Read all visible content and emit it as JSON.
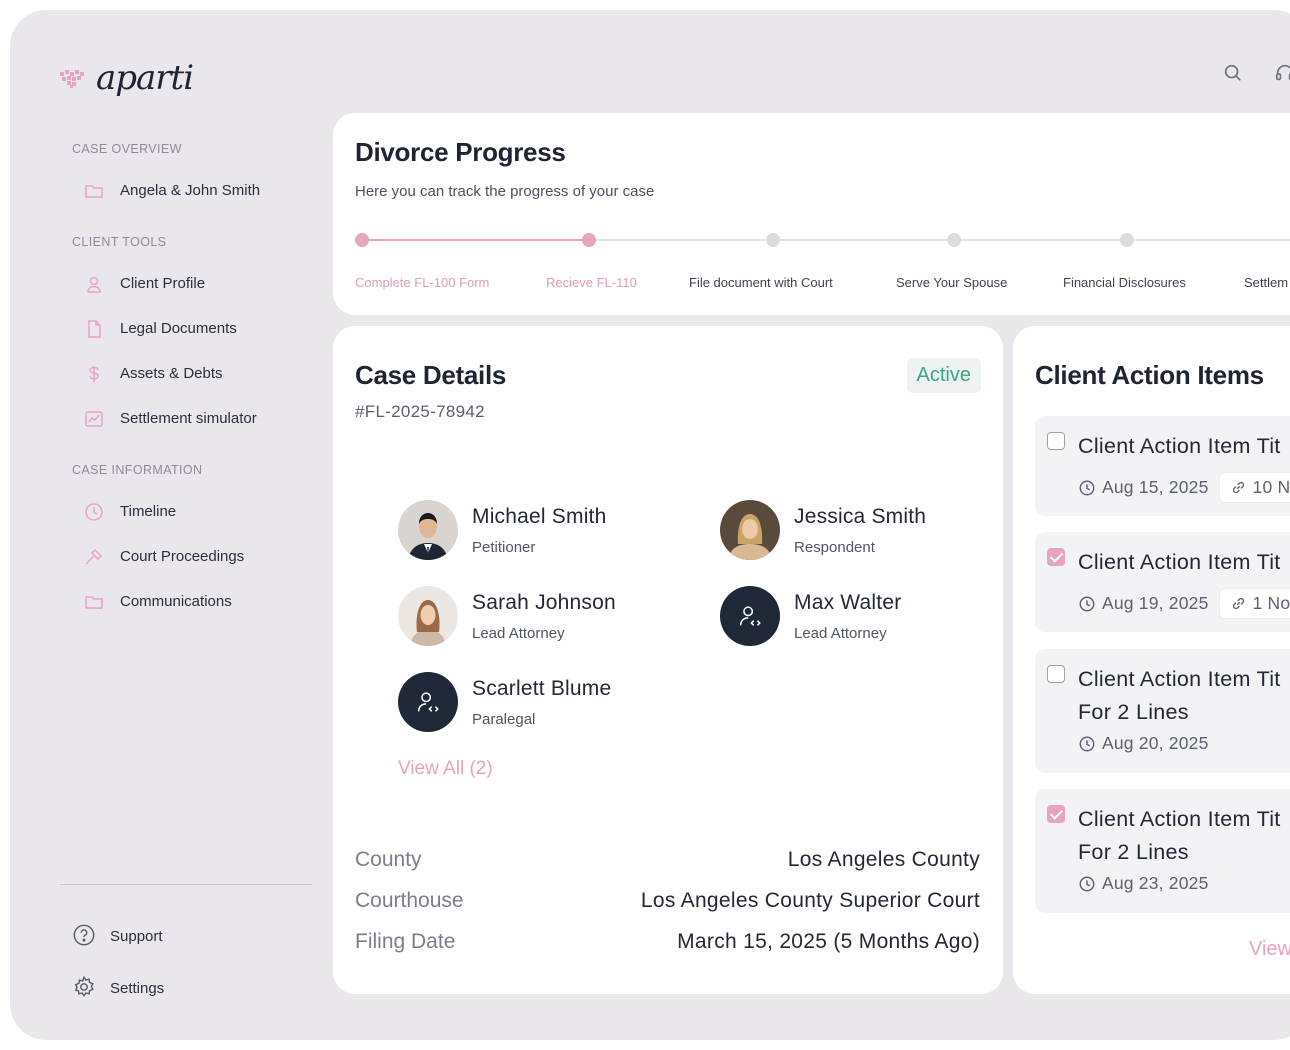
{
  "brand": {
    "name": "aparti",
    "accent": "#e7a3c0"
  },
  "top_icons": [
    "search-icon",
    "headset-icon"
  ],
  "sidebar": {
    "sections": [
      {
        "heading": "CASE OVERVIEW",
        "items": [
          {
            "label": "Angela & John Smith",
            "icon": "folder-icon"
          }
        ]
      },
      {
        "heading": "CLIENT TOOLS",
        "items": [
          {
            "label": "Client Profile",
            "icon": "user-icon"
          },
          {
            "label": "Legal Documents",
            "icon": "document-icon"
          },
          {
            "label": "Assets & Debts",
            "icon": "dollar-icon"
          },
          {
            "label": "Settlement simulator",
            "icon": "chart-icon"
          }
        ]
      },
      {
        "heading": "CASE INFORMATION",
        "items": [
          {
            "label": "Timeline",
            "icon": "clock-icon"
          },
          {
            "label": "Court Proceedings",
            "icon": "gavel-icon"
          },
          {
            "label": "Communications",
            "icon": "folder-icon"
          }
        ]
      }
    ],
    "bottom": [
      {
        "label": "Support",
        "icon": "help-icon"
      },
      {
        "label": "Settings",
        "icon": "gear-icon"
      }
    ]
  },
  "progress": {
    "title": "Divorce Progress",
    "subtitle": "Here you can track the progress of your case",
    "completed_steps": 2,
    "steps": [
      "Complete FL-100 Form",
      "Recieve FL-110",
      "File document with Court",
      "Serve Your Spouse",
      "Financial Disclosures",
      "Settlem"
    ]
  },
  "case_details": {
    "title": "Case Details",
    "case_number": "#FL-2025-78942",
    "status": "Active",
    "status_color": "#3aa58a",
    "people": [
      {
        "name": "Michael Smith",
        "role": "Petitioner",
        "avatar": "photo"
      },
      {
        "name": "Jessica Smith",
        "role": "Respondent",
        "avatar": "photo"
      },
      {
        "name": "Sarah Johnson",
        "role": "Lead Attorney",
        "avatar": "photo"
      },
      {
        "name": "Max Walter",
        "role": "Lead Attorney",
        "avatar": "placeholder"
      },
      {
        "name": "Scarlett Blume",
        "role": "Paralegal",
        "avatar": "placeholder"
      }
    ],
    "view_all": "View All (2)",
    "info": [
      {
        "key": "County",
        "value": "Los Angeles County"
      },
      {
        "key": "Courthouse",
        "value": "Los Angeles County Superior Court"
      },
      {
        "key": "Filing Date",
        "value": "March 15, 2025 (5 Months Ago)"
      }
    ]
  },
  "action_items": {
    "title": "Client Action Items",
    "items": [
      {
        "title": "Client Action Item Tit",
        "title2": "",
        "date": "Aug 15, 2025",
        "notes": "10 N",
        "checked": false
      },
      {
        "title": "Client Action Item Tit",
        "title2": "",
        "date": "Aug 19, 2025",
        "notes": "1 No",
        "checked": true
      },
      {
        "title": "Client Action Item Tit",
        "title2": "For 2 Lines",
        "date": "Aug 20, 2025",
        "notes": "",
        "checked": false
      },
      {
        "title": "Client Action Item Tit",
        "title2": "For 2 Lines",
        "date": "Aug 23, 2025",
        "notes": "",
        "checked": true
      }
    ],
    "view_link": "View"
  }
}
